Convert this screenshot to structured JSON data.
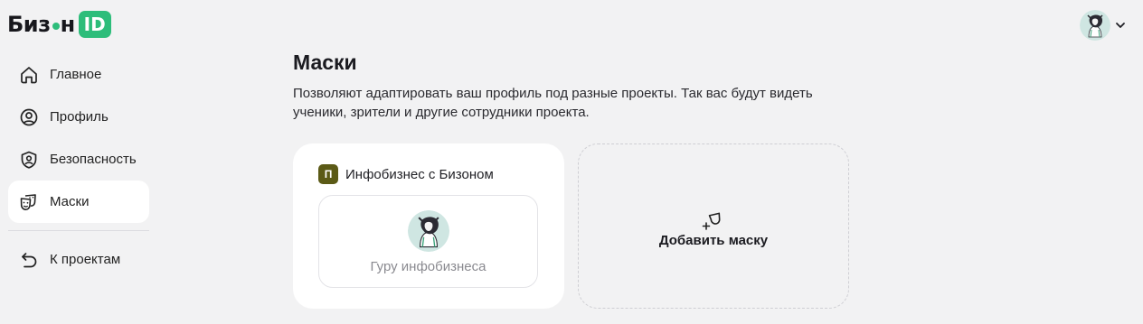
{
  "logo": {
    "text_left": "Биз",
    "text_right": "н",
    "badge": "ID"
  },
  "user": {
    "avatar": "user-avatar",
    "menu_icon": "chevron-down-icon"
  },
  "sidebar": {
    "items": [
      {
        "label": "Главное",
        "icon": "home-icon",
        "active": false
      },
      {
        "label": "Профиль",
        "icon": "user-circle-icon",
        "active": false
      },
      {
        "label": "Безопасность",
        "icon": "shield-icon",
        "active": false
      },
      {
        "label": "Маски",
        "icon": "masks-icon",
        "active": true
      }
    ],
    "back": {
      "label": "К проектам",
      "icon": "back-arrow-icon"
    }
  },
  "main": {
    "title": "Маски",
    "description": "Позволяют адаптировать ваш профиль под разные проекты. Так вас будут видеть ученики, зрители и другие сотрудники проекта.",
    "mask_card": {
      "project_badge": "П",
      "project_name": "Инфобизнес с Бизоном",
      "mask_name": "Гуру инфобизнеса"
    },
    "add_card": {
      "label": "Добавить маску",
      "icon": "add-mask-icon"
    }
  },
  "colors": {
    "accent": "#2dbd7a",
    "background": "#f2f2f3",
    "project_badge": "#5b5a16"
  }
}
